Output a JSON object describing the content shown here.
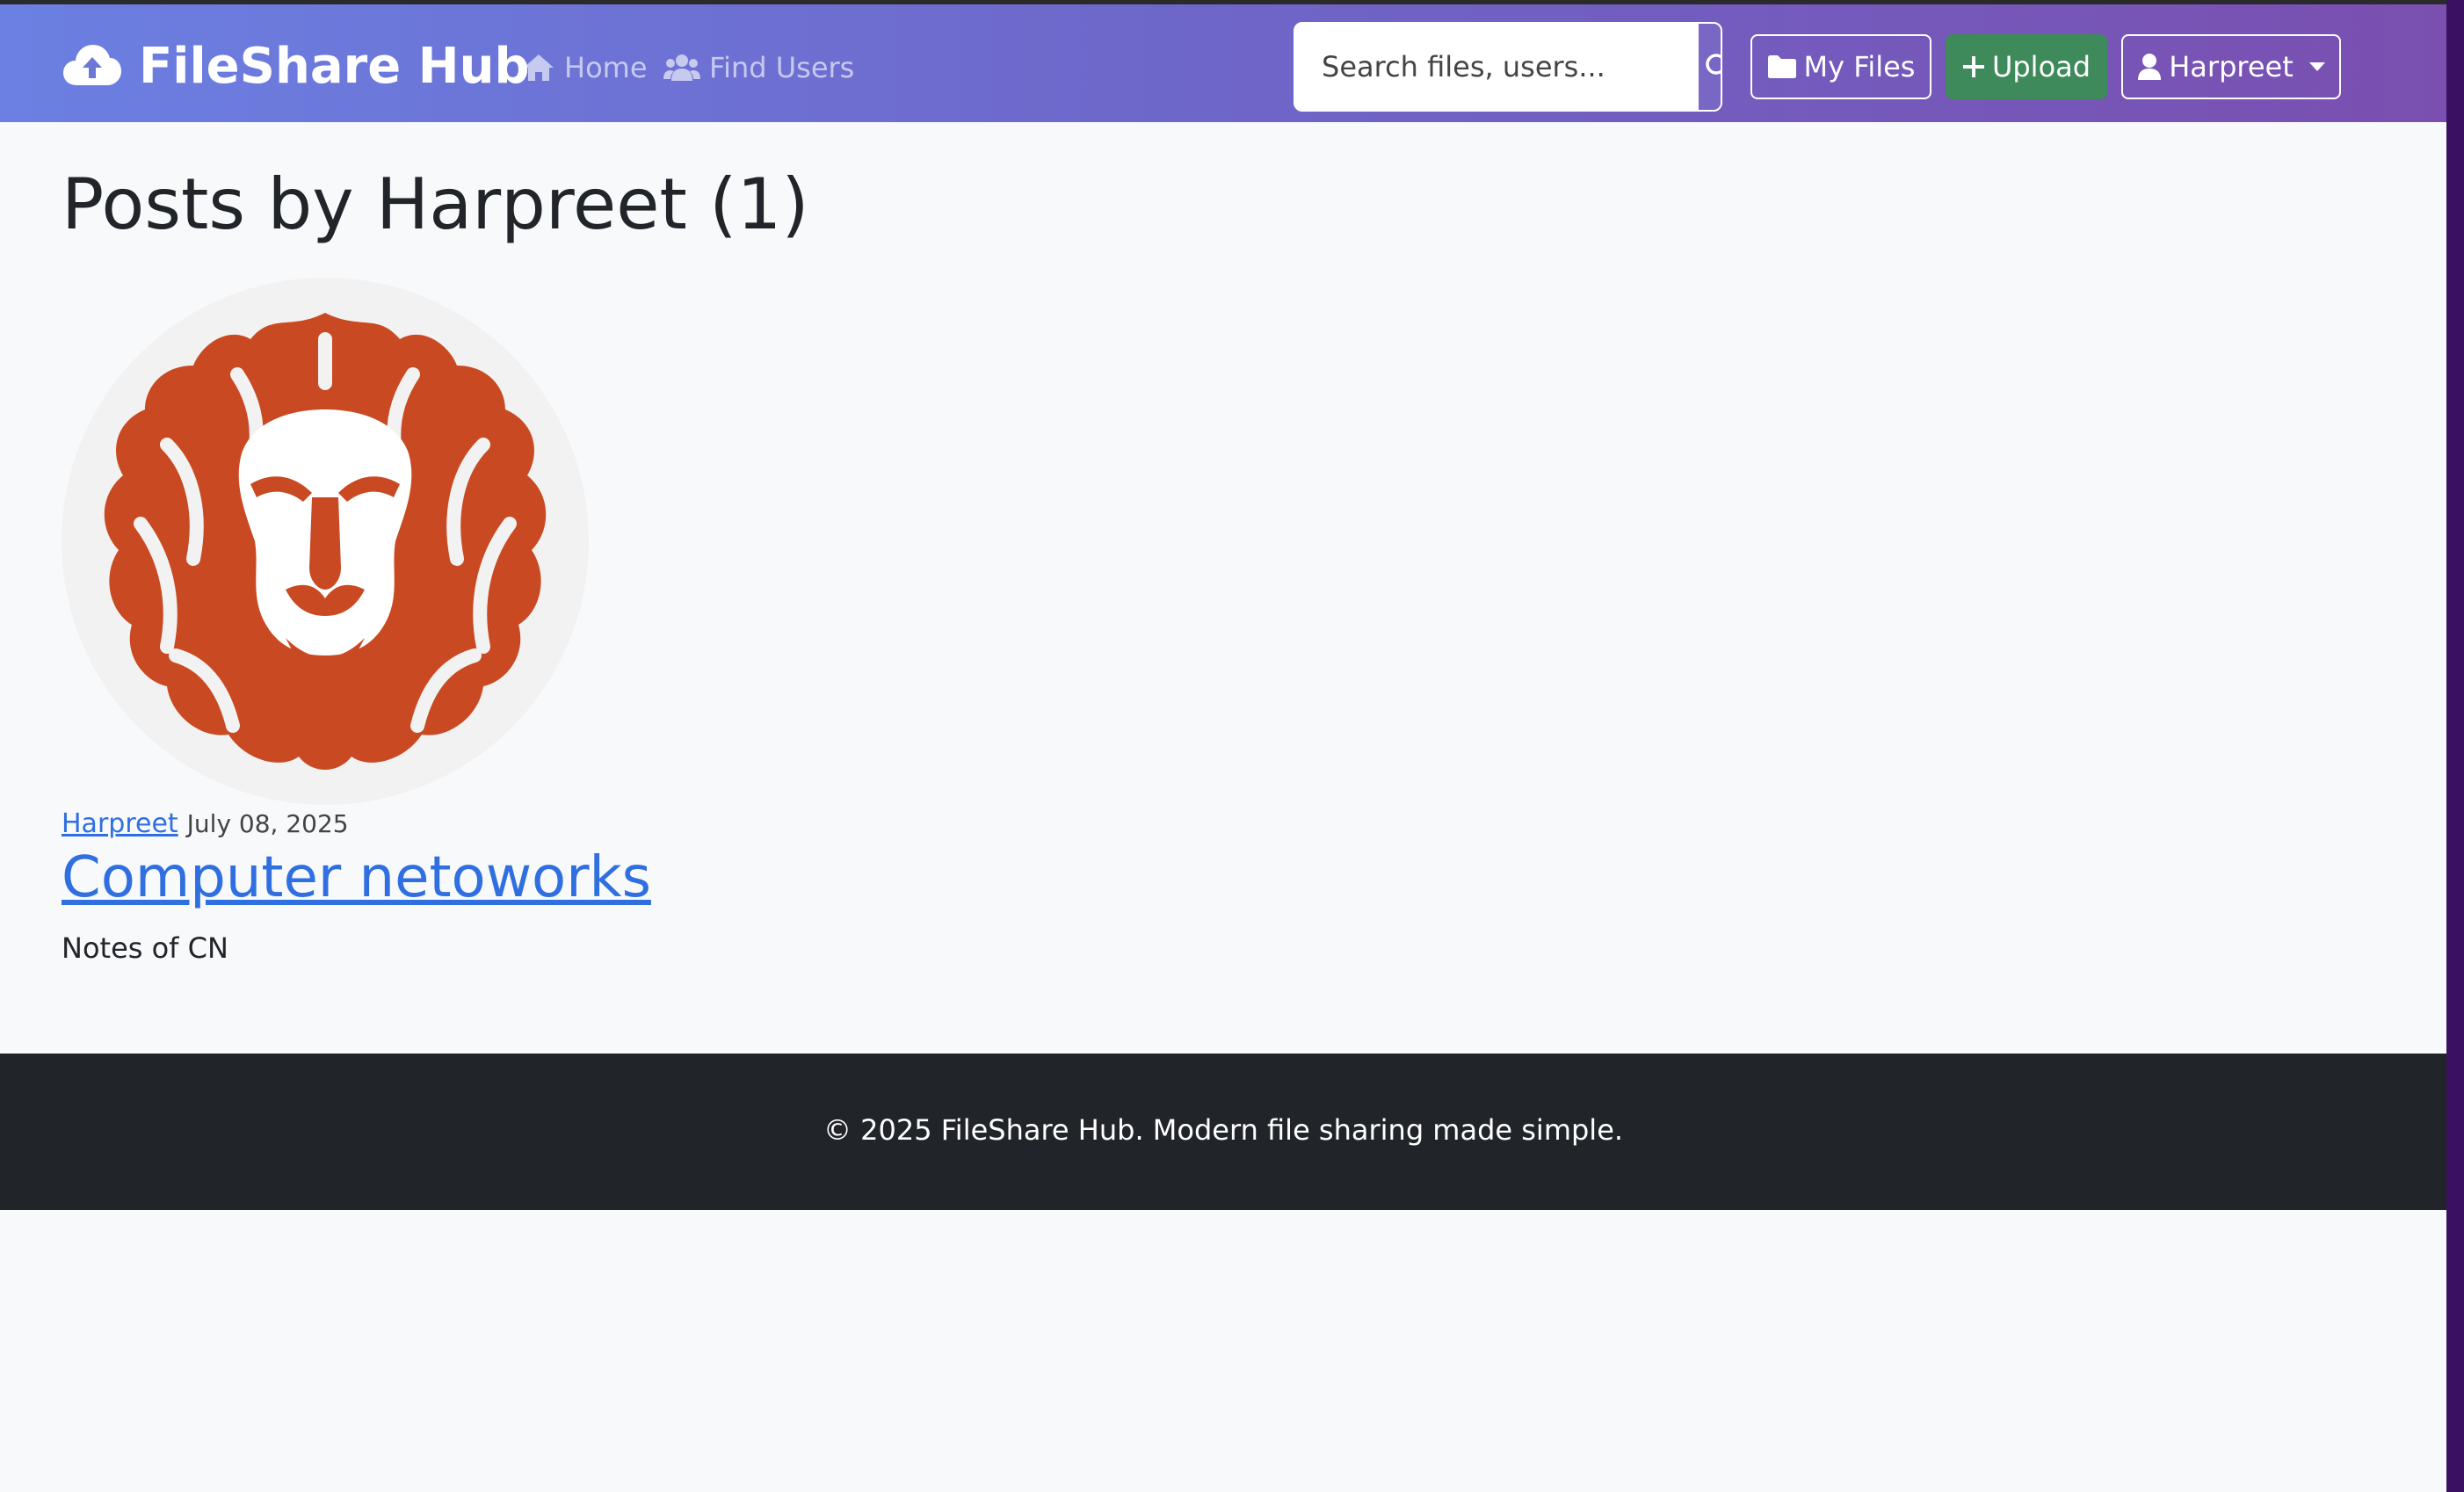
{
  "brand": {
    "name": "FileShare Hub",
    "icon": "cloud-upload-icon"
  },
  "nav": {
    "items": [
      {
        "label": "Home",
        "icon": "home-icon"
      },
      {
        "label": "Find Users",
        "icon": "users-icon"
      }
    ]
  },
  "search": {
    "placeholder": "Search files, users...",
    "value": "",
    "button_icon": "search-icon"
  },
  "actions": {
    "my_files_label": "My Files",
    "upload_label": "Upload",
    "user_label": "Harpreet"
  },
  "main": {
    "title": "Posts by Harpreet (1)",
    "posts": [
      {
        "author": "Harpreet",
        "date": "July 08, 2025",
        "title": "Computer netoworks",
        "description": "Notes of CN",
        "image": "lion-logo"
      }
    ]
  },
  "footer": {
    "text": "© 2025 FileShare Hub. Modern file sharing made simple."
  },
  "colors": {
    "navbar_start": "#6b80e2",
    "navbar_end": "#7a4fb0",
    "upload_green": "#3e8a5a",
    "link_blue": "#2f6fe0",
    "lion_orange": "#c94a22",
    "footer_bg": "#212529"
  }
}
